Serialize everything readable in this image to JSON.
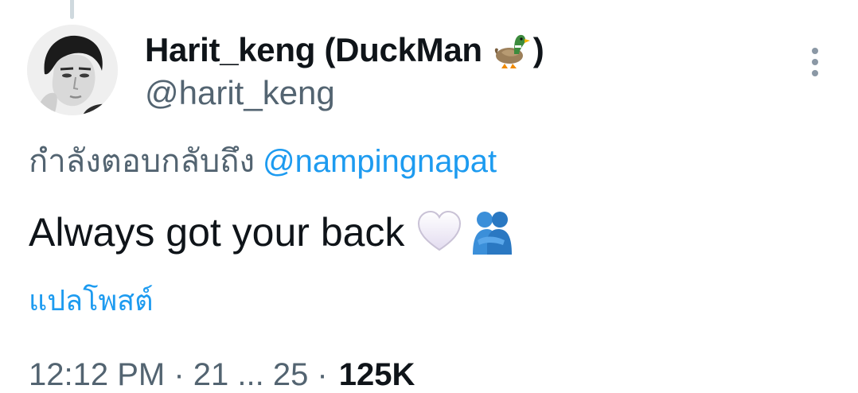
{
  "tweet": {
    "author": {
      "display_name": "Harit_keng (DuckMan",
      "display_name_end": ")",
      "name_emoji": "duck-icon",
      "handle": "@harit_keng"
    },
    "reply_to_prefix": "กำลังตอบกลับถึง",
    "reply_to_handle": "@nampingnapat",
    "text": "Always got your back",
    "text_emojis": [
      "white-heart-icon",
      "people-hugging-icon"
    ],
    "translate_label": "แปลโพสต์",
    "meta_partial": "12:12 PM · 21 ... 25 ·",
    "views_partial": "125K"
  },
  "colors": {
    "text_primary": "#0f1419",
    "text_secondary": "#536471",
    "link": "#1d9bf0",
    "thread_line": "#cfd9de"
  }
}
